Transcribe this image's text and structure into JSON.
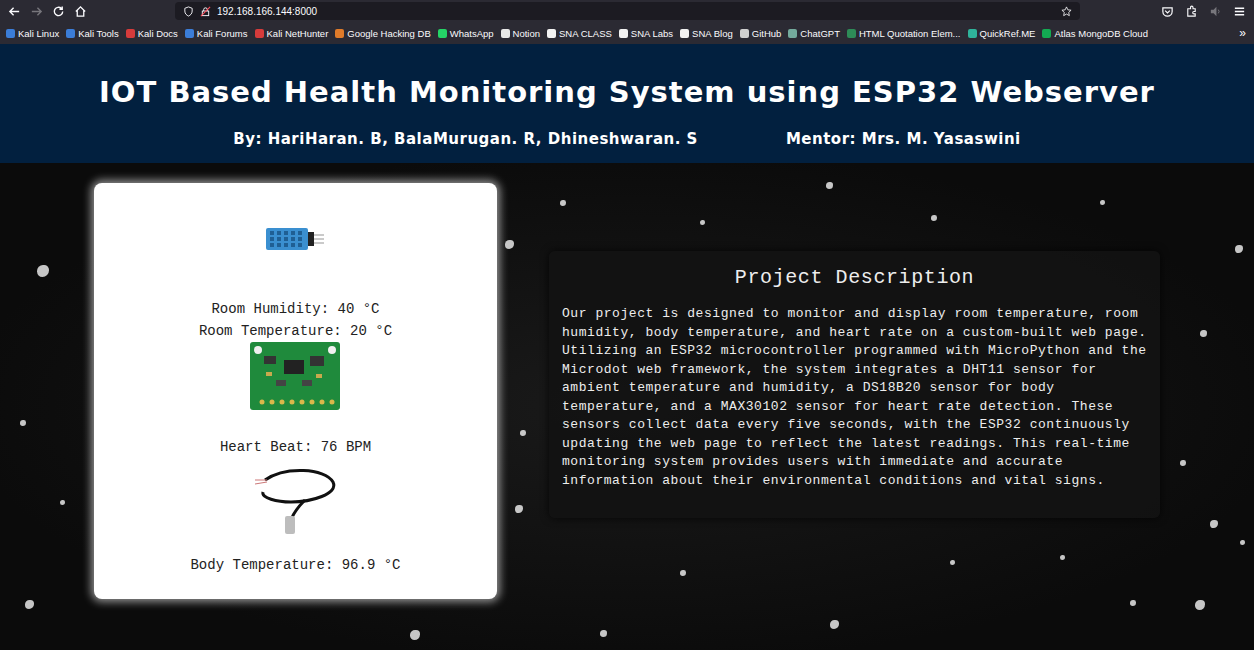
{
  "browser": {
    "address": "192.168.166.144:8000",
    "bookmarks": [
      {
        "label": "Kali Linux",
        "color": "#3b7dd8"
      },
      {
        "label": "Kali Tools",
        "color": "#3b7dd8"
      },
      {
        "label": "Kali Docs",
        "color": "#d63b3b"
      },
      {
        "label": "Kali Forums",
        "color": "#3b7dd8"
      },
      {
        "label": "Kali NetHunter",
        "color": "#d63b3b"
      },
      {
        "label": "Google Hacking DB",
        "color": "#e07b2a"
      },
      {
        "label": "WhatsApp",
        "color": "#25d366"
      },
      {
        "label": "Notion",
        "color": "#e8e8e8"
      },
      {
        "label": "SNA CLASS",
        "color": "#f2f2f2"
      },
      {
        "label": "SNA Labs",
        "color": "#f2f2f2"
      },
      {
        "label": "SNA Blog",
        "color": "#f2f2f2"
      },
      {
        "label": "GitHub",
        "color": "#d0d0d0"
      },
      {
        "label": "ChatGPT",
        "color": "#74aa9c"
      },
      {
        "label": "HTML Quotation Elem...",
        "color": "#2e8b57"
      },
      {
        "label": "QuickRef.ME",
        "color": "#2fb39b"
      },
      {
        "label": "Atlas MongoDB Cloud",
        "color": "#13aa52"
      }
    ],
    "bookmarks_overflow": "»"
  },
  "header": {
    "title": "IOT Based Health Monitoring System using ESP32 Webserver",
    "authors": "By: HariHaran. B, BalaMurugan. R, Dhineshwaran. S",
    "mentor": "Mentor: Mrs. M. Yasaswini"
  },
  "sensors": [
    {
      "kind": "dht11",
      "readings": [
        "Room Humidity: 40 °C",
        "Room Temperature: 20 °C"
      ]
    },
    {
      "kind": "max30102",
      "readings": [
        "Heart Beat: 76 BPM"
      ]
    },
    {
      "kind": "ds18b20",
      "readings": [
        "Body Temperature: 96.9 °C"
      ]
    }
  ],
  "description": {
    "title": "Project Description",
    "text": "Our project is designed to monitor and display room temperature, room humidity, body temperature, and heart rate on a custom-built web page. Utilizing an ESP32 microcontroller programmed with MicroPython and the Microdot web framework, the system integrates a DHT11 sensor for ambient temperature and humidity, a DS18B20 sensor for body temperature, and a MAX30102 sensor for heart rate detection. These sensors collect data every five seconds, with the ESP32 continuously updating the web page to reflect the latest readings. This real-time monitoring system provides users with immediate and accurate information about their environmental conditions and vital signs."
  }
}
